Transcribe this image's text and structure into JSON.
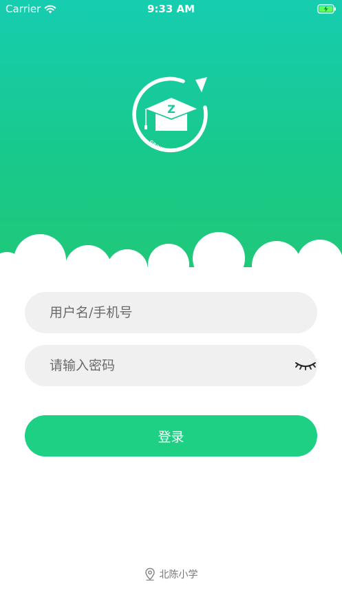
{
  "status_bar": {
    "carrier": "Carrier",
    "time": "9:33 AM",
    "wifi_icon": "wifi-icon",
    "battery_icon": "battery-charging-icon"
  },
  "logo": {
    "letter": "Z",
    "tagline": "GROWTH COMPASS",
    "icon": "graduation-cap-icon"
  },
  "form": {
    "username_placeholder": "用户名/手机号",
    "password_placeholder": "请输入密码",
    "password_toggle_icon": "eye-closed-icon",
    "login_label": "登录"
  },
  "footer": {
    "school_icon": "location-pin-icon",
    "school_name": "北陈小学"
  },
  "colors": {
    "header_top": "#16cdb0",
    "header_bottom": "#20c877",
    "button": "#1ed083",
    "input_bg": "#f0f0f0"
  }
}
